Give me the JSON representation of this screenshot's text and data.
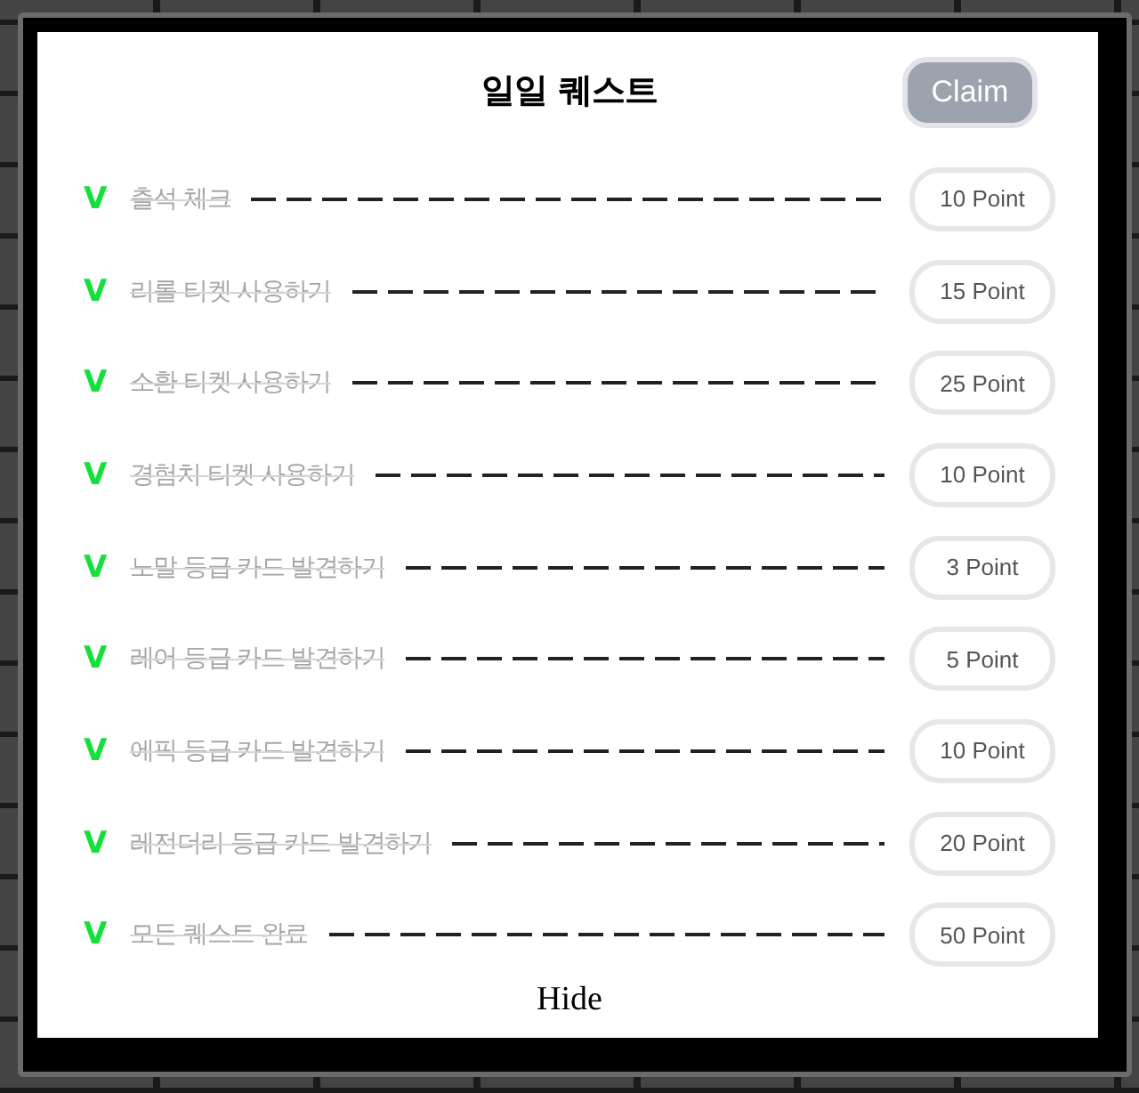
{
  "title": "일일 퀘스트",
  "claim": {
    "label": "Claim",
    "disabled": true
  },
  "quests": [
    {
      "mark": "V",
      "label": "출석 체크",
      "done": true,
      "reward": "10 Point"
    },
    {
      "mark": "V",
      "label": "리롤 티켓 사용하기",
      "done": true,
      "reward": "15 Point"
    },
    {
      "mark": "V",
      "label": "소환 티켓 사용하기",
      "done": true,
      "reward": "25 Point"
    },
    {
      "mark": "V",
      "label": "경험치 티켓 사용하기",
      "done": true,
      "reward": "10 Point"
    },
    {
      "mark": "V",
      "label": "노말 등급 카드 발견하기",
      "done": true,
      "reward": "3 Point"
    },
    {
      "mark": "V",
      "label": "레어 등급 카드 발견하기",
      "done": true,
      "reward": "5 Point"
    },
    {
      "mark": "V",
      "label": "에픽 등급 카드 발견하기",
      "done": true,
      "reward": "10 Point"
    },
    {
      "mark": "V",
      "label": "레전더리 등급 카드 발견하기",
      "done": true,
      "reward": "20 Point"
    },
    {
      "mark": "V",
      "label": "모든 퀘스트 완료",
      "done": true,
      "reward": "50 Point"
    }
  ],
  "hide": "Hide"
}
